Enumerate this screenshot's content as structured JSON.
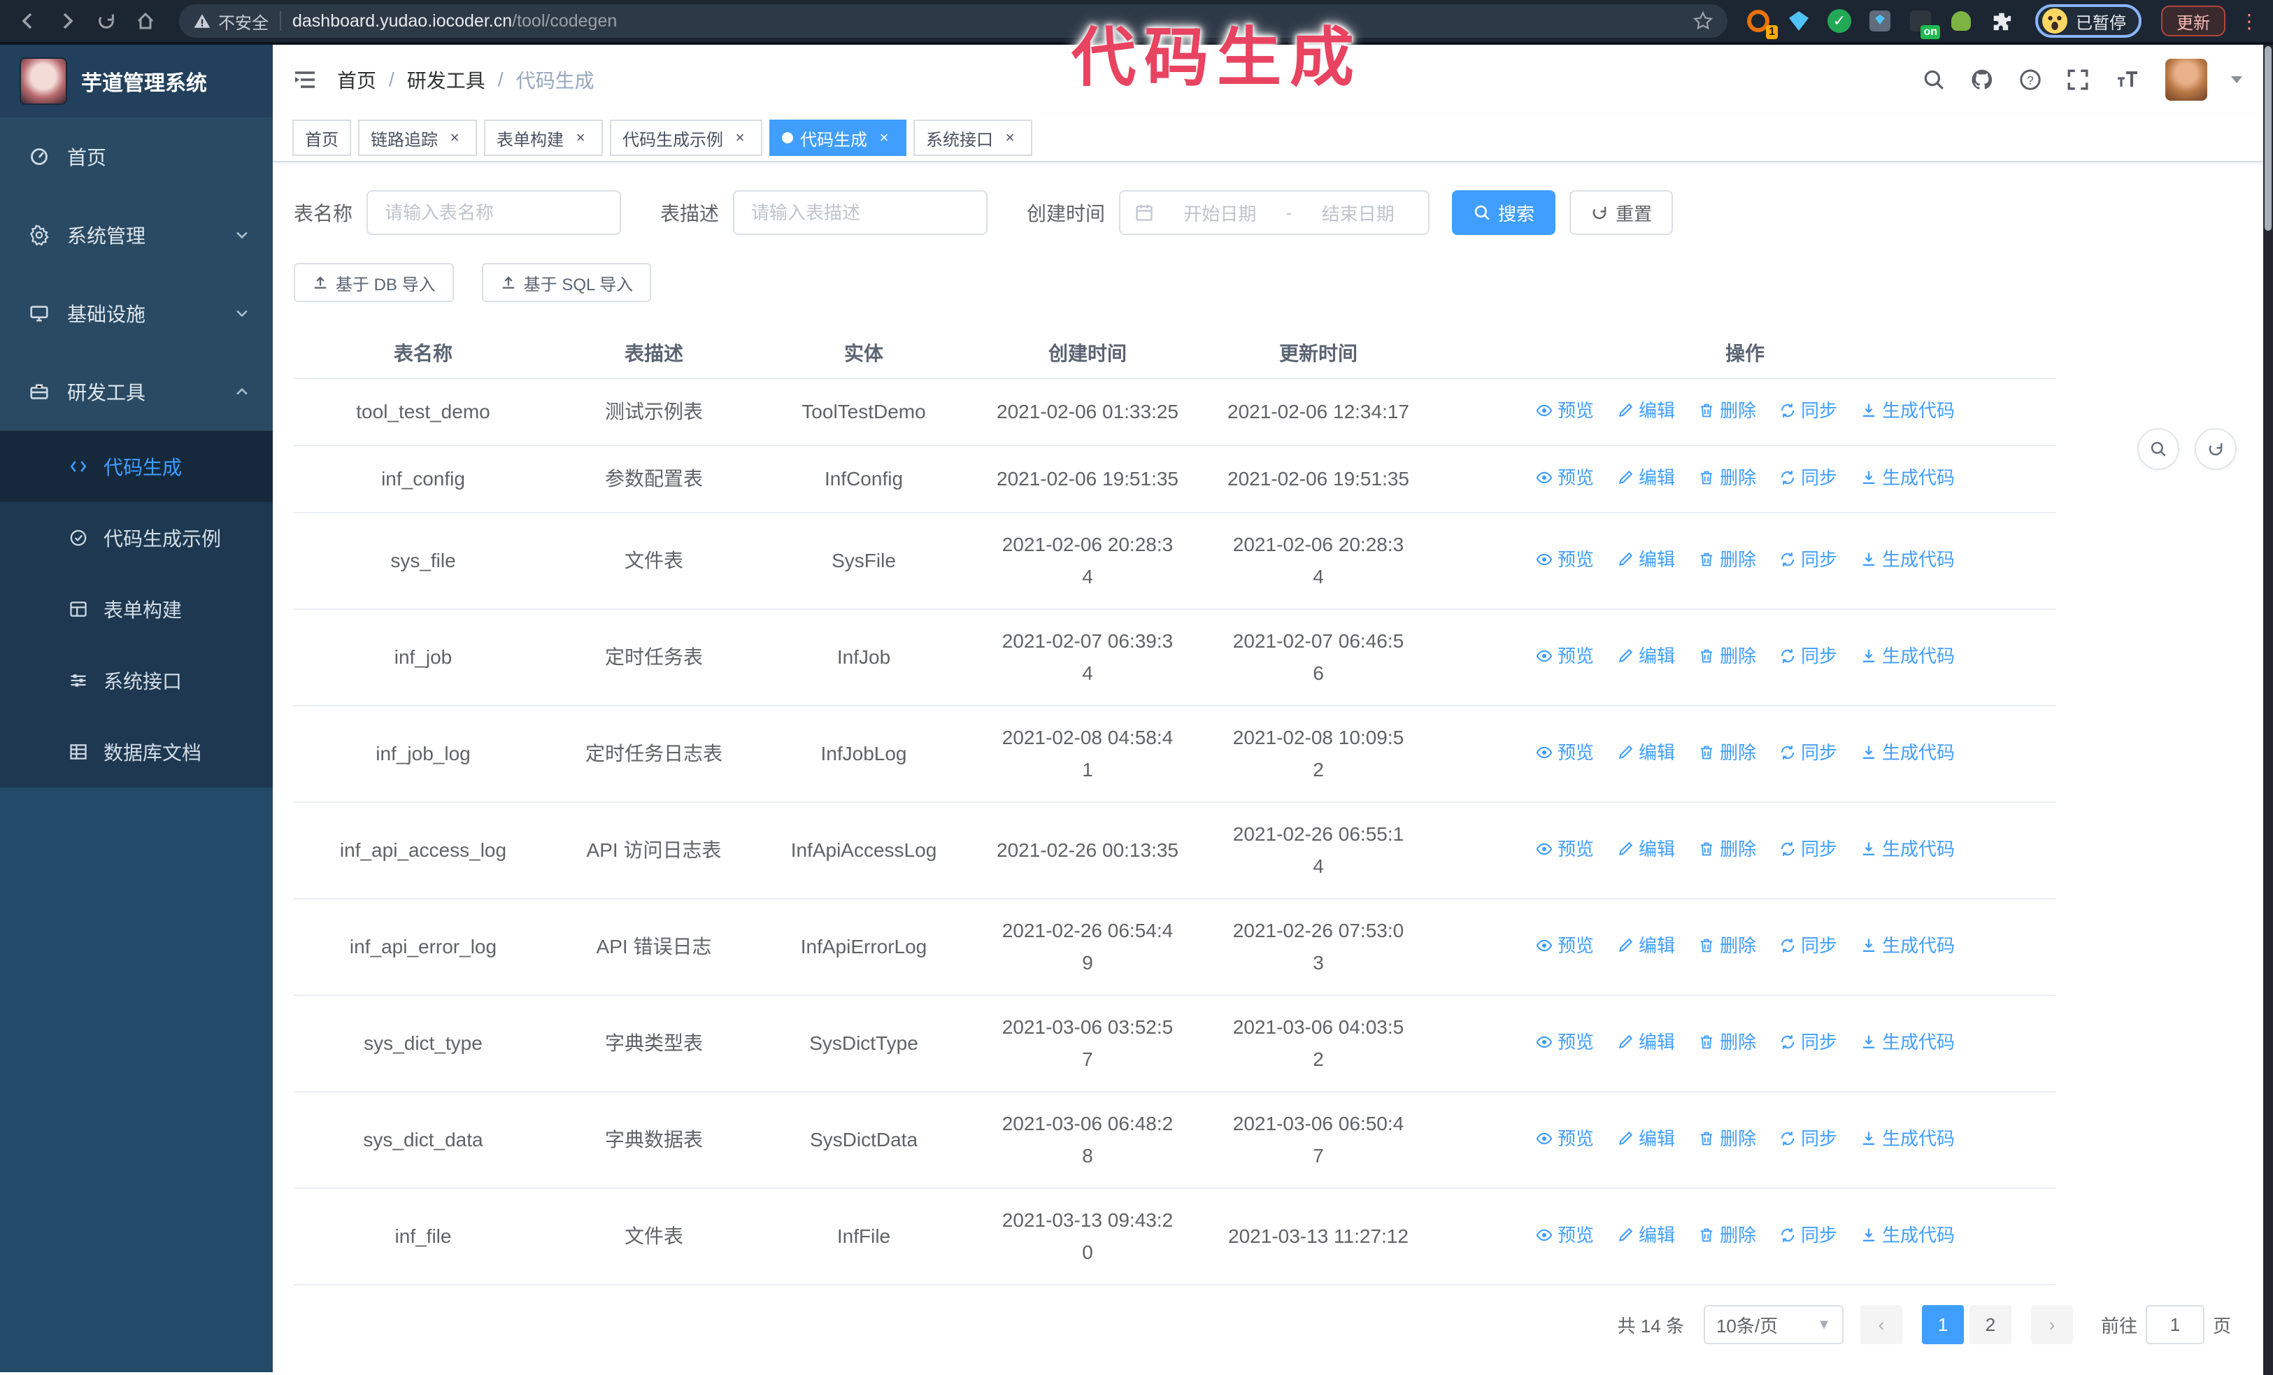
{
  "browser": {
    "security_label": "不安全",
    "url_host": "dashboard.yudao.iocoder.cn",
    "url_path": "/tool/codegen",
    "extension_badge": "1",
    "extension_on_badge": "on",
    "profile_status": "已暂停",
    "update_label": "更新"
  },
  "annotation": {
    "text": "代码生成",
    "color": "#e84360"
  },
  "sidebar": {
    "logo_title": "芋道管理系统",
    "items": [
      {
        "label": "首页",
        "icon": "dashboard-icon",
        "expand": ""
      },
      {
        "label": "系统管理",
        "icon": "gear-icon",
        "expand": "down"
      },
      {
        "label": "基础设施",
        "icon": "infrastructure-icon",
        "expand": "down"
      },
      {
        "label": "研发工具",
        "icon": "tools-icon",
        "expand": "up"
      }
    ],
    "submenu": [
      {
        "label": "代码生成",
        "icon": "code-icon",
        "active": true
      },
      {
        "label": "代码生成示例",
        "icon": "example-icon",
        "active": false
      },
      {
        "label": "表单构建",
        "icon": "form-icon",
        "active": false
      },
      {
        "label": "系统接口",
        "icon": "api-icon",
        "active": false
      },
      {
        "label": "数据库文档",
        "icon": "database-doc-icon",
        "active": false
      }
    ]
  },
  "header": {
    "breadcrumb": [
      "首页",
      "研发工具",
      "代码生成"
    ]
  },
  "tabs": [
    {
      "label": "首页",
      "closable": false,
      "active": false
    },
    {
      "label": "链路追踪",
      "closable": true,
      "active": false
    },
    {
      "label": "表单构建",
      "closable": true,
      "active": false
    },
    {
      "label": "代码生成示例",
      "closable": true,
      "active": false
    },
    {
      "label": "代码生成",
      "closable": true,
      "active": true
    },
    {
      "label": "系统接口",
      "closable": true,
      "active": false
    }
  ],
  "search": {
    "name_label": "表名称",
    "name_placeholder": "请输入表名称",
    "desc_label": "表描述",
    "desc_placeholder": "请输入表描述",
    "time_label": "创建时间",
    "start_placeholder": "开始日期",
    "range_separator": "-",
    "end_placeholder": "结束日期",
    "search_label": "搜索",
    "reset_label": "重置"
  },
  "toolbar": {
    "import_db_label": "基于 DB 导入",
    "import_sql_label": "基于 SQL 导入"
  },
  "table": {
    "columns": [
      "表名称",
      "表描述",
      "实体",
      "创建时间",
      "更新时间",
      "操作"
    ],
    "action_labels": [
      "预览",
      "编辑",
      "删除",
      "同步",
      "生成代码"
    ],
    "rows": [
      {
        "name": "tool_test_demo",
        "desc": "测试示例表",
        "entity": "ToolTestDemo",
        "created": "2021-02-06 01:33:25",
        "updated": "2021-02-06 12:34:17"
      },
      {
        "name": "inf_config",
        "desc": "参数配置表",
        "entity": "InfConfig",
        "created": "2021-02-06 19:51:35",
        "updated": "2021-02-06 19:51:35"
      },
      {
        "name": "sys_file",
        "desc": "文件表",
        "entity": "SysFile",
        "created": "2021-02-06 20:28:3\n4",
        "updated": "2021-02-06 20:28:3\n4"
      },
      {
        "name": "inf_job",
        "desc": "定时任务表",
        "entity": "InfJob",
        "created": "2021-02-07 06:39:3\n4",
        "updated": "2021-02-07 06:46:5\n6"
      },
      {
        "name": "inf_job_log",
        "desc": "定时任务日志表",
        "entity": "InfJobLog",
        "created": "2021-02-08 04:58:4\n1",
        "updated": "2021-02-08 10:09:5\n2"
      },
      {
        "name": "inf_api_access_log",
        "desc": "API 访问日志表",
        "entity": "InfApiAccessLog",
        "created": "2021-02-26 00:13:35",
        "updated": "2021-02-26 06:55:1\n4"
      },
      {
        "name": "inf_api_error_log",
        "desc": "API 错误日志",
        "entity": "InfApiErrorLog",
        "created": "2021-02-26 06:54:4\n9",
        "updated": "2021-02-26 07:53:0\n3"
      },
      {
        "name": "sys_dict_type",
        "desc": "字典类型表",
        "entity": "SysDictType",
        "created": "2021-03-06 03:52:5\n7",
        "updated": "2021-03-06 04:03:5\n2"
      },
      {
        "name": "sys_dict_data",
        "desc": "字典数据表",
        "entity": "SysDictData",
        "created": "2021-03-06 06:48:2\n8",
        "updated": "2021-03-06 06:50:4\n7"
      },
      {
        "name": "inf_file",
        "desc": "文件表",
        "entity": "InfFile",
        "created": "2021-03-13 09:43:2\n0",
        "updated": "2021-03-13 11:27:12"
      }
    ]
  },
  "pagination": {
    "total": "共 14 条",
    "page_size": "10条/页",
    "pages": [
      "1",
      "2"
    ],
    "active_page": "1",
    "jumper_prefix": "前往",
    "jumper_value": "1",
    "jumper_suffix": "页"
  },
  "colors": {
    "accent": "#409eff",
    "sidebar_bg": "#2a4a63",
    "submenu_bg": "#1d3850",
    "chrome_bg": "#1c2532",
    "annotation": "#e84360"
  }
}
